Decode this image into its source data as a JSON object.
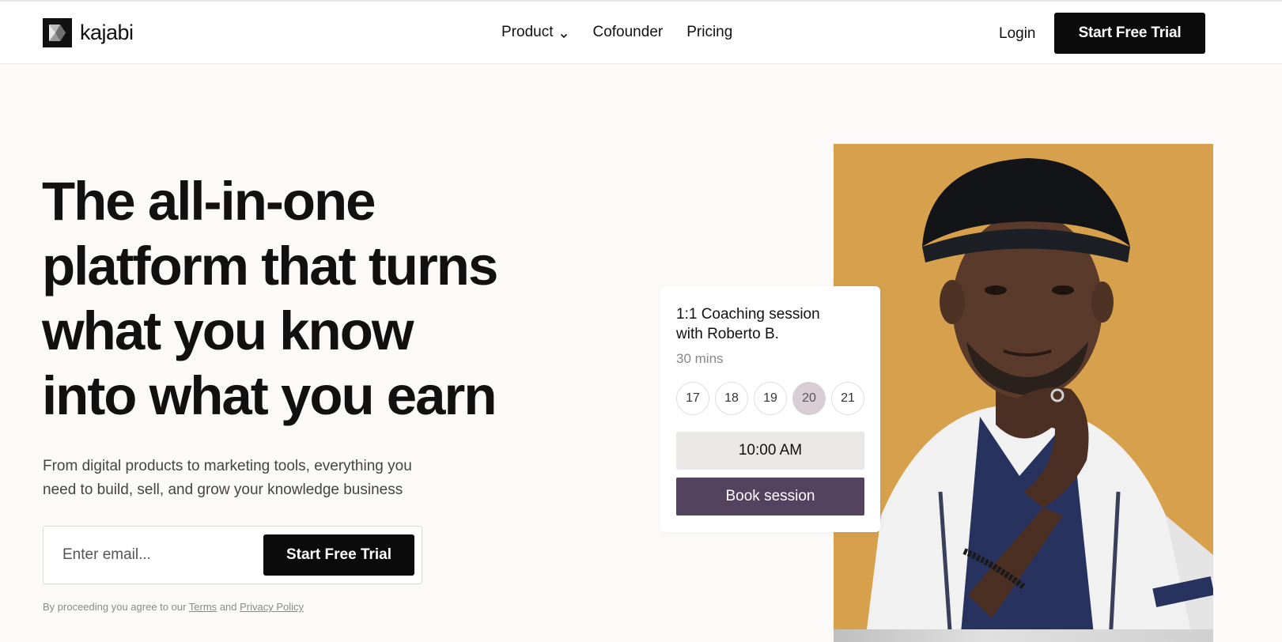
{
  "header": {
    "logo_text": "kajabi",
    "nav": [
      {
        "label": "Product",
        "has_dropdown": true
      },
      {
        "label": "Cofounder"
      },
      {
        "label": "Pricing"
      }
    ],
    "login_label": "Login",
    "cta_label": "Start Free Trial"
  },
  "hero": {
    "title_lines": [
      "The all-in-one",
      "platform that turns",
      "what you know",
      "into what you earn"
    ],
    "subtitle_lines": [
      "From digital products to marketing tools, everything you",
      "need to build, sell, and grow your knowledge business"
    ],
    "email_placeholder": "Enter email...",
    "cta_label": "Start Free Trial",
    "legal_prefix": "By proceeding you agree to our",
    "legal_terms": "Terms",
    "legal_and": "and",
    "legal_privacy": "Privacy Policy"
  },
  "booking_card": {
    "title_lines": [
      "1:1 Coaching session",
      "with Roberto B."
    ],
    "duration": "30 mins",
    "dates": [
      "17",
      "18",
      "19",
      "20",
      "21"
    ],
    "selected_date": "20",
    "time": "10:00 AM",
    "book_label": "Book session"
  },
  "colors": {
    "accent_dark": "#0b0b0b",
    "photo_bg": "#d6a04d",
    "book_button": "#54435f",
    "selected_date": "#d9cdd6"
  },
  "icons": [
    "logo-icon",
    "chevron-down-icon"
  ]
}
